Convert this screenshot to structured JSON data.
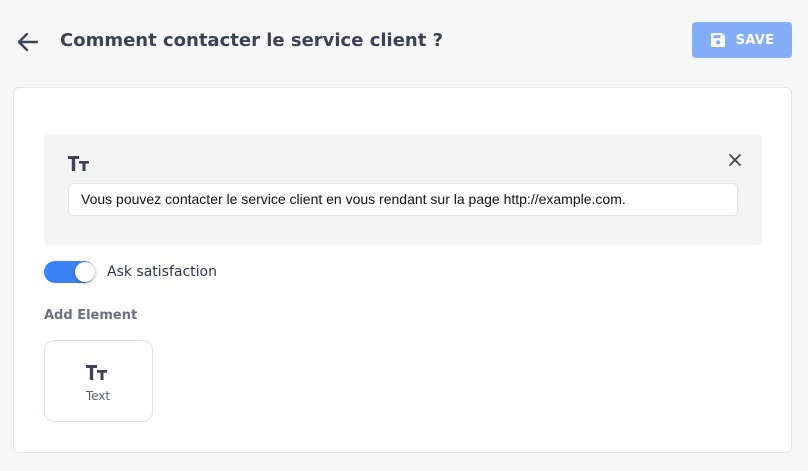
{
  "header": {
    "title": "Comment contacter le service client ?",
    "save_label": "SAVE",
    "back_icon": "arrow-left-icon",
    "save_icon": "floppy-disk-icon"
  },
  "editor": {
    "text_element": {
      "type_icon": "text-type-icon",
      "value": "Vous pouvez contacter le service client en vous rendant sur la page http://example.com.",
      "close_icon": "close-icon"
    },
    "ask_satisfaction": {
      "label": "Ask satisfaction",
      "enabled": true
    },
    "add_element": {
      "title": "Add Element",
      "options": [
        {
          "label": "Text",
          "icon": "text-type-icon"
        }
      ]
    }
  },
  "colors": {
    "accent": "#3b82f6",
    "save_button": "#84aef7",
    "title_text": "#3c4256",
    "background": "#f7f7f8"
  }
}
